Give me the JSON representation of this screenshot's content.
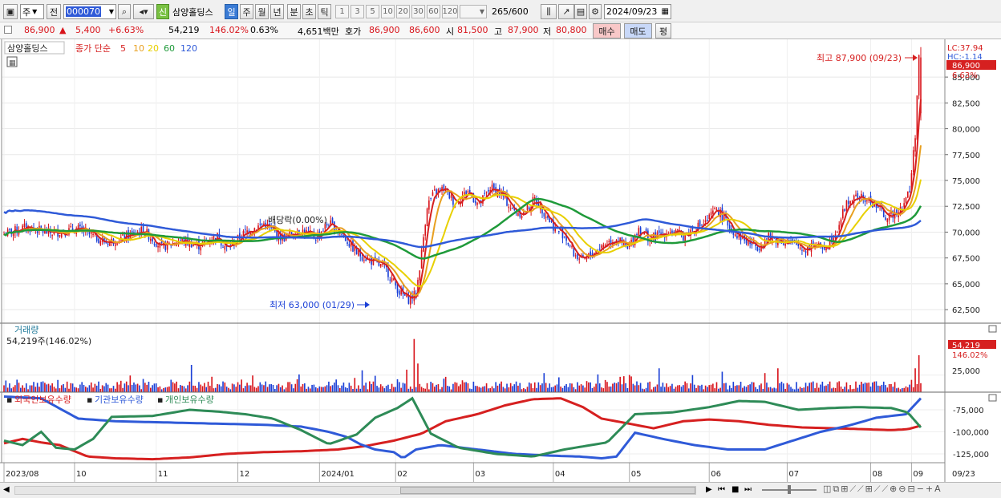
{
  "toolbar": {
    "mode": "주",
    "prev": "전",
    "code": "000070",
    "badge": "신",
    "stock_name": "삼양홀딩스",
    "periods": [
      "일",
      "주",
      "월",
      "년",
      "분",
      "초",
      "틱"
    ],
    "active_period": "일",
    "nums": [
      "1",
      "3",
      "5",
      "10",
      "20",
      "30",
      "60",
      "120"
    ],
    "count": "265",
    "count_total": "/600",
    "date": "2024/09/23"
  },
  "info": {
    "price": "86,900",
    "arrow": "▲",
    "change": "5,400",
    "change_pct": "+6.63%",
    "volume": "54,219",
    "volume_ratio": "146.02%",
    "turnover": "0.63%",
    "amount": "4,651백만",
    "hoga_label": "호가",
    "hoga1": "86,900",
    "hoga2": "86,600",
    "open_label": "시",
    "open": "81,500",
    "high_label": "고",
    "high": "87,900",
    "low_label": "저",
    "low": "80,800",
    "buy": "매수",
    "sell": "매도",
    "avg": "평"
  },
  "legend": {
    "name": "삼양홀딩스",
    "label": "종가 단순",
    "mas": [
      {
        "p": "5",
        "color": "#d62020"
      },
      {
        "p": "10",
        "color": "#e8a020"
      },
      {
        "p": "20",
        "color": "#e8d000"
      },
      {
        "p": "60",
        "color": "#1f9a3a"
      },
      {
        "p": "120",
        "color": "#2f5ad8"
      }
    ]
  },
  "price_annotations": {
    "lc": "LC:37.94",
    "hc": "HC:-1.14",
    "current": "86,900",
    "current_pct": "6.63%",
    "high_label": "최고 87,900 (09/23)",
    "low_label": "최저 63,000 (01/29)",
    "dividend": "배당락(0.00%)"
  },
  "volume_panel": {
    "title": "거래량",
    "value": "54,219주(146.02%)",
    "current": "54,219",
    "current_pct": "146.02%",
    "tick": "25,000"
  },
  "holding_panel": {
    "series": [
      {
        "name": "외국인보유수량",
        "color": "#d62020"
      },
      {
        "name": "기관보유수량",
        "color": "#2f5ad8"
      },
      {
        "name": "개인보유수량",
        "color": "#2e8b57"
      }
    ],
    "ticks": [
      "-75,000",
      "-100,000",
      "-125,000"
    ]
  },
  "x_axis": [
    "2023/08",
    "10",
    "11",
    "12",
    "2024/01",
    "02",
    "03",
    "04",
    "05",
    "06",
    "07",
    "08",
    "09",
    "09/23"
  ],
  "colors": {
    "up": "#d8141b",
    "down": "#1a3fd6"
  },
  "chart_data": [
    {
      "type": "candlestick",
      "ylim": [
        61500,
        88500
      ],
      "yticks": [
        62500,
        65000,
        67500,
        70000,
        72500,
        75000,
        77500,
        80000,
        82500,
        85000
      ],
      "x_months": [
        "2023/08",
        "10",
        "11",
        "12",
        "2024/01",
        "02",
        "03",
        "04",
        "05",
        "06",
        "07",
        "08",
        "09"
      ],
      "close_path": [
        [
          0,
          69800
        ],
        [
          12,
          70500
        ],
        [
          25,
          69900
        ],
        [
          40,
          70300
        ],
        [
          55,
          69000
        ],
        [
          65,
          69500
        ],
        [
          75,
          70200
        ],
        [
          85,
          68500
        ],
        [
          95,
          69200
        ],
        [
          105,
          68700
        ],
        [
          115,
          69600
        ],
        [
          120,
          68400
        ],
        [
          130,
          70000
        ],
        [
          140,
          70800
        ],
        [
          150,
          69400
        ],
        [
          160,
          70200
        ],
        [
          168,
          69500
        ],
        [
          175,
          70900
        ],
        [
          182,
          69800
        ],
        [
          190,
          68000
        ],
        [
          198,
          67200
        ],
        [
          206,
          66400
        ],
        [
          213,
          64200
        ],
        [
          218,
          63500
        ],
        [
          222,
          64000
        ],
        [
          225,
          68000
        ],
        [
          228,
          72600
        ],
        [
          232,
          73800
        ],
        [
          237,
          74200
        ],
        [
          243,
          72800
        ],
        [
          250,
          74000
        ],
        [
          256,
          72600
        ],
        [
          262,
          74300
        ],
        [
          268,
          73700
        ],
        [
          274,
          72100
        ],
        [
          280,
          71800
        ],
        [
          286,
          73200
        ],
        [
          292,
          71700
        ],
        [
          297,
          70300
        ],
        [
          302,
          69700
        ],
        [
          307,
          67900
        ],
        [
          312,
          67200
        ],
        [
          318,
          68100
        ],
        [
          324,
          68900
        ],
        [
          330,
          69400
        ],
        [
          336,
          68300
        ],
        [
          342,
          70400
        ],
        [
          348,
          69300
        ],
        [
          354,
          69800
        ],
        [
          360,
          70100
        ],
        [
          366,
          69600
        ],
        [
          372,
          70400
        ],
        [
          378,
          70900
        ],
        [
          384,
          72300
        ],
        [
          389,
          71000
        ],
        [
          394,
          69900
        ],
        [
          400,
          69100
        ],
        [
          406,
          68600
        ],
        [
          412,
          69500
        ],
        [
          418,
          69200
        ],
        [
          425,
          68900
        ],
        [
          432,
          68300
        ],
        [
          436,
          69000
        ],
        [
          440,
          68400
        ],
        [
          444,
          68800
        ],
        [
          449,
          70400
        ],
        [
          454,
          72800
        ],
        [
          460,
          73400
        ],
        [
          466,
          73000
        ],
        [
          471,
          72400
        ],
        [
          476,
          71300
        ],
        [
          480,
          71900
        ],
        [
          484,
          72600
        ],
        [
          488,
          74000
        ],
        [
          491,
          79500
        ],
        [
          493,
          86900
        ]
      ],
      "high": 87900,
      "low": 63000,
      "annotations": [
        "최고 87,900 (09/23)",
        "최저 63,000 (01/29)",
        "배당락(0.00%)"
      ]
    },
    {
      "type": "bar",
      "name": "거래량",
      "ylim": [
        0,
        80000
      ],
      "last_value": 54219,
      "spikes": [
        [
          101,
          40000
        ],
        [
          159,
          26000
        ],
        [
          193,
          32000
        ],
        [
          217,
          33000
        ],
        [
          221,
          78000
        ],
        [
          223,
          42000
        ],
        [
          291,
          28000
        ],
        [
          320,
          26000
        ],
        [
          353,
          35000
        ],
        [
          387,
          30000
        ],
        [
          410,
          28000
        ],
        [
          417,
          35000
        ],
        [
          489,
          18000
        ],
        [
          491,
          35000
        ],
        [
          493,
          54219
        ]
      ]
    },
    {
      "type": "line",
      "name": "보유수량",
      "ylim": [
        -135000,
        -55000
      ],
      "yticks": [
        -75000,
        -100000,
        -125000
      ],
      "series": [
        {
          "name": "외국인보유수량",
          "points": [
            [
              0,
              -113000
            ],
            [
              10,
              -108000
            ],
            [
              20,
              -112000
            ],
            [
              30,
              -115000
            ],
            [
              45,
              -128000
            ],
            [
              60,
              -130000
            ],
            [
              80,
              -131000
            ],
            [
              100,
              -129000
            ],
            [
              120,
              -125000
            ],
            [
              140,
              -123000
            ],
            [
              160,
              -122000
            ],
            [
              180,
              -120000
            ],
            [
              195,
              -116000
            ],
            [
              210,
              -110000
            ],
            [
              225,
              -102000
            ],
            [
              238,
              -88000
            ],
            [
              255,
              -80000
            ],
            [
              270,
              -70000
            ],
            [
              285,
              -63000
            ],
            [
              300,
              -62000
            ],
            [
              312,
              -72000
            ],
            [
              322,
              -85000
            ],
            [
              335,
              -90000
            ],
            [
              350,
              -96000
            ],
            [
              366,
              -88000
            ],
            [
              380,
              -86000
            ],
            [
              396,
              -88000
            ],
            [
              412,
              -92000
            ],
            [
              430,
              -95000
            ],
            [
              448,
              -96000
            ],
            [
              463,
              -97000
            ],
            [
              478,
              -98000
            ],
            [
              487,
              -97000
            ],
            [
              494,
              -93000
            ]
          ]
        },
        {
          "name": "기관보유수량",
          "points": [
            [
              0,
              -60000
            ],
            [
              20,
              -62000
            ],
            [
              40,
              -85000
            ],
            [
              60,
              -88000
            ],
            [
              80,
              -89000
            ],
            [
              100,
              -90000
            ],
            [
              120,
              -91000
            ],
            [
              140,
              -92000
            ],
            [
              160,
              -94000
            ],
            [
              175,
              -100000
            ],
            [
              185,
              -106000
            ],
            [
              192,
              -114000
            ],
            [
              200,
              -120000
            ],
            [
              210,
              -123000
            ],
            [
              215,
              -130000
            ],
            [
              222,
              -120000
            ],
            [
              235,
              -115000
            ],
            [
              255,
              -120000
            ],
            [
              275,
              -125000
            ],
            [
              295,
              -127000
            ],
            [
              310,
              -128000
            ],
            [
              322,
              -130000
            ],
            [
              330,
              -128000
            ],
            [
              340,
              -101000
            ],
            [
              355,
              -108000
            ],
            [
              372,
              -115000
            ],
            [
              390,
              -120000
            ],
            [
              410,
              -120000
            ],
            [
              425,
              -110000
            ],
            [
              440,
              -100000
            ],
            [
              455,
              -93000
            ],
            [
              470,
              -84000
            ],
            [
              486,
              -80000
            ],
            [
              494,
              -62000
            ]
          ]
        },
        {
          "name": "개인보유수량",
          "points": [
            [
              0,
              -110000
            ],
            [
              10,
              -115000
            ],
            [
              20,
              -100000
            ],
            [
              28,
              -118000
            ],
            [
              38,
              -120000
            ],
            [
              48,
              -108000
            ],
            [
              58,
              -83000
            ],
            [
              80,
              -82000
            ],
            [
              100,
              -75000
            ],
            [
              115,
              -77000
            ],
            [
              130,
              -80000
            ],
            [
              145,
              -85000
            ],
            [
              160,
              -98000
            ],
            [
              175,
              -114000
            ],
            [
              190,
              -103000
            ],
            [
              200,
              -84000
            ],
            [
              212,
              -73000
            ],
            [
              220,
              -62000
            ],
            [
              230,
              -102000
            ],
            [
              245,
              -118000
            ],
            [
              265,
              -125000
            ],
            [
              285,
              -128000
            ],
            [
              302,
              -120000
            ],
            [
              325,
              -112000
            ],
            [
              340,
              -80000
            ],
            [
              360,
              -78000
            ],
            [
              380,
              -72000
            ],
            [
              396,
              -65000
            ],
            [
              410,
              -66000
            ],
            [
              428,
              -75000
            ],
            [
              445,
              -73000
            ],
            [
              460,
              -72000
            ],
            [
              478,
              -73000
            ],
            [
              487,
              -78000
            ],
            [
              494,
              -95000
            ]
          ]
        }
      ]
    }
  ]
}
